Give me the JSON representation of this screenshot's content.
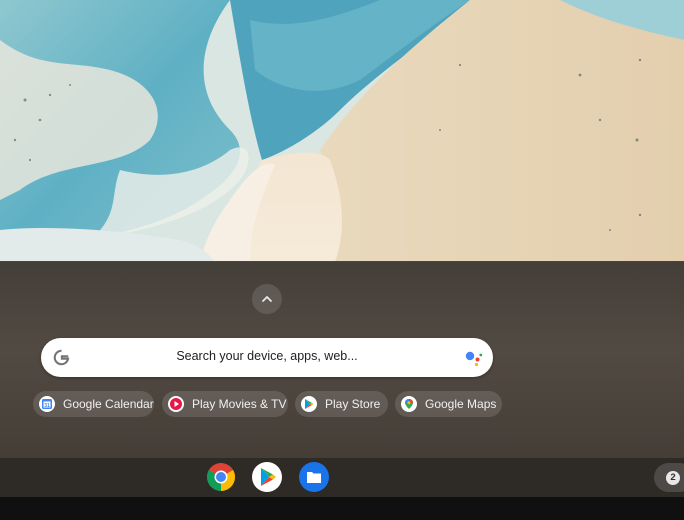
{
  "launcher": {
    "expand_icon": "chevron-up-icon",
    "search_placeholder": "Search your device, apps, web...",
    "search_icon": "google-g-icon",
    "assistant_icon": "google-assistant-icon",
    "suggestions": [
      {
        "label": "Google Calendar",
        "icon": "google-calendar-icon"
      },
      {
        "label": "Play Movies & TV",
        "icon": "play-movies-icon"
      },
      {
        "label": "Play Store",
        "icon": "play-store-icon"
      },
      {
        "label": "Google Maps",
        "icon": "google-maps-icon"
      }
    ]
  },
  "shelf": {
    "apps": [
      {
        "name": "Chrome",
        "icon": "chrome-icon"
      },
      {
        "name": "Play Store",
        "icon": "play-store-icon"
      },
      {
        "name": "Files",
        "icon": "files-icon"
      }
    ],
    "notification_count": "2"
  },
  "colors": {
    "google_blue": "#4285F4",
    "google_red": "#EA4335",
    "google_yellow": "#FBBC05",
    "google_green": "#34A853",
    "files_blue": "#1A73E8"
  }
}
